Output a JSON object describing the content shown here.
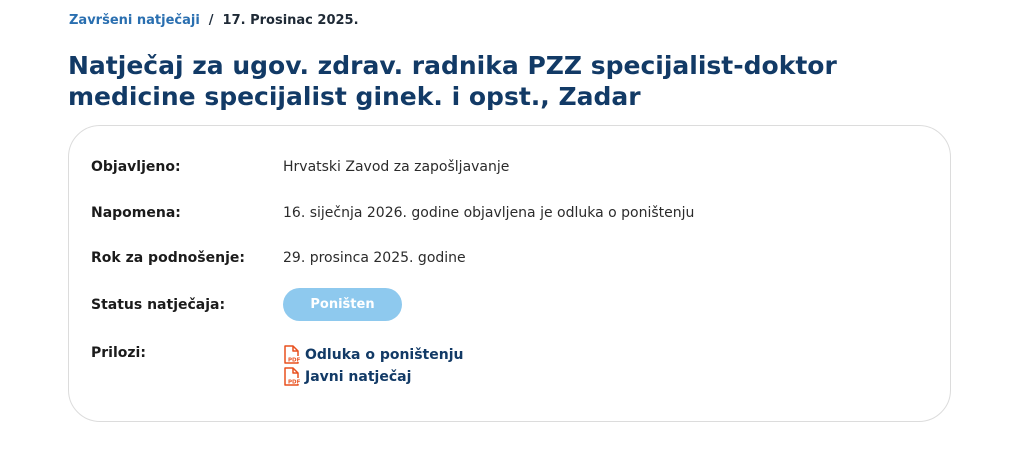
{
  "breadcrumb": {
    "parent_label": "Završeni natječaji",
    "separator": "/",
    "current_label": "17. Prosinac 2025."
  },
  "page": {
    "title": "Natječaj za ugov. zdrav. radnika PZZ specijalist-doktor medicine specijalist ginek. i opst., Zadar"
  },
  "details": {
    "published_label": "Objavljeno:",
    "published_value": "Hrvatski Zavod za zapošljavanje",
    "note_label": "Napomena:",
    "note_value": "16. siječnja 2026. godine objavljena je odluka o poništenju",
    "deadline_label": "Rok za podnošenje:",
    "deadline_value": "29. prosinca 2025. godine",
    "status_label": "Status natječaja:",
    "status_value": "Poništen",
    "attachments_label": "Prilozi:",
    "attachments": [
      {
        "label": "Odluka o poništenju",
        "icon": "pdf-icon"
      },
      {
        "label": "Javni natječaj",
        "icon": "pdf-icon"
      }
    ]
  },
  "colors": {
    "title": "#123a66",
    "breadcrumb_link": "#2a6fb0",
    "status_pill": "#8ec9ee",
    "pdf_icon": "#e8501f"
  }
}
